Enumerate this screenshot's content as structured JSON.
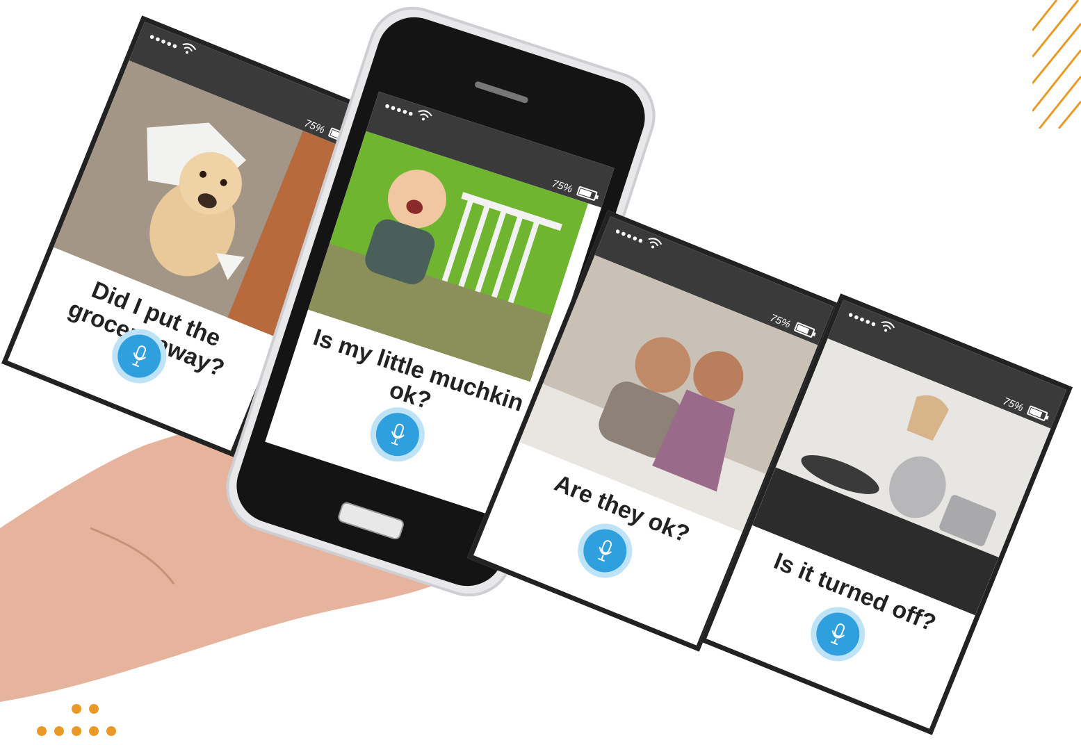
{
  "cards": [
    {
      "question": "Did I put the grocery away?",
      "battery": "75%",
      "photo": "dog-in-torn-paper"
    },
    {
      "question": "Is my little muchkin ok?",
      "battery": "75%",
      "photo": "baby-crawling"
    },
    {
      "question": "Are they ok?",
      "battery": "75%",
      "photo": "elderly-couple"
    },
    {
      "question": "Is it turned  off?",
      "battery": "75%",
      "photo": "kitchen-stove"
    }
  ],
  "icons": {
    "mic": "microphone-icon",
    "wifi": "wifi-icon",
    "battery": "battery-icon",
    "signal": "signal-dots-icon"
  },
  "colors": {
    "accent_orange": "#e99a26",
    "mic_blue": "#2f9fdd",
    "mic_halo": "#bfe3f6",
    "status_bar": "#3a3a3a"
  }
}
